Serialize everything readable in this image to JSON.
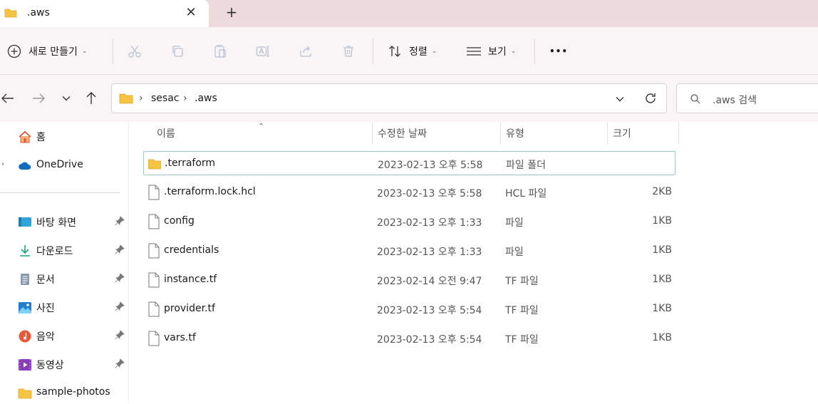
{
  "tab": {
    "title": ".aws",
    "close_glyph": "✕",
    "new_glyph": "+"
  },
  "toolbar": {
    "new_label": "새로 만들기",
    "sort_label": "정렬",
    "view_label": "보기",
    "more_glyph": "•••",
    "icons": [
      "plus-circle-icon",
      "cut-icon",
      "copy-icon",
      "paste-icon",
      "rename-icon",
      "share-icon",
      "delete-icon",
      "sort-icon",
      "view-icon",
      "more-icon"
    ]
  },
  "address": {
    "crumbs": [
      "sesac",
      ".aws"
    ],
    "separator": "›",
    "search_placeholder": ".aws 검색"
  },
  "sidebar": {
    "items": [
      {
        "label": "홈",
        "icon": "home-icon"
      },
      {
        "label": "OneDrive",
        "icon": "cloud-icon"
      },
      {
        "label": "바탕 화면",
        "icon": "desktop-icon"
      },
      {
        "label": "다운로드",
        "icon": "download-icon"
      },
      {
        "label": "문서",
        "icon": "document-icon"
      },
      {
        "label": "사진",
        "icon": "pictures-icon"
      },
      {
        "label": "음악",
        "icon": "music-icon"
      },
      {
        "label": "동영상",
        "icon": "video-icon"
      },
      {
        "label": "sample-photos",
        "icon": "folder-icon"
      }
    ]
  },
  "columns": {
    "name": "이름",
    "date": "수정한 날짜",
    "type": "유형",
    "size": "크기"
  },
  "files": [
    {
      "name": ".terraform",
      "date": "2023-02-13 오후 5:58",
      "type": "파일 폴더",
      "size": "",
      "kind": "folder"
    },
    {
      "name": ".terraform.lock.hcl",
      "date": "2023-02-13 오후 5:58",
      "type": "HCL 파일",
      "size": "2KB",
      "kind": "file"
    },
    {
      "name": "config",
      "date": "2023-02-13 오후 1:33",
      "type": "파일",
      "size": "1KB",
      "kind": "file"
    },
    {
      "name": "credentials",
      "date": "2023-02-13 오후 1:33",
      "type": "파일",
      "size": "1KB",
      "kind": "file"
    },
    {
      "name": "instance.tf",
      "date": "2023-02-14 오전 9:47",
      "type": "TF 파일",
      "size": "1KB",
      "kind": "file"
    },
    {
      "name": "provider.tf",
      "date": "2023-02-13 오후 5:54",
      "type": "TF 파일",
      "size": "1KB",
      "kind": "file"
    },
    {
      "name": "vars.tf",
      "date": "2023-02-13 오후 5:54",
      "type": "TF 파일",
      "size": "1KB",
      "kind": "file"
    }
  ],
  "colors": {
    "folder": "#f6c342",
    "accent": "#0067c0",
    "selection_border": "#9cc8d1"
  }
}
